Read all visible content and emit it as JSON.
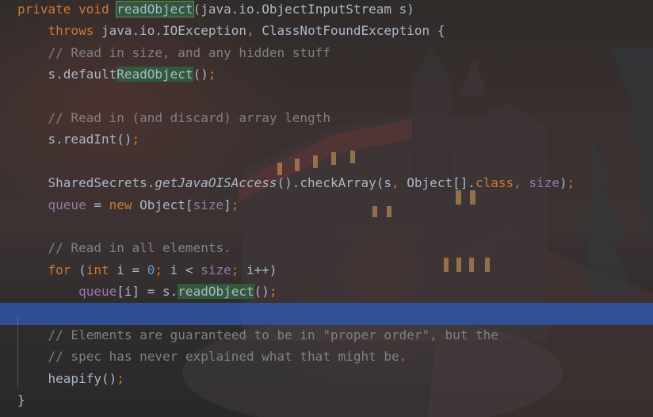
{
  "editor": {
    "lines": [
      {
        "y": 0,
        "tokens": [
          {
            "t": "private void ",
            "c": "kw"
          },
          {
            "t": "readObject",
            "c": "pl hl-box"
          },
          {
            "t": "(java.io.ObjectInputStream s)",
            "c": "pl"
          }
        ]
      },
      {
        "y": 1,
        "tokens": [
          {
            "t": "    throws ",
            "c": "kw"
          },
          {
            "t": "java.io.IOException",
            "c": "pl"
          },
          {
            "t": ", ",
            "c": "kw"
          },
          {
            "t": "ClassNotFoundException {",
            "c": "pl"
          }
        ]
      },
      {
        "y": 2,
        "tokens": [
          {
            "t": "    // Read in size, and any hidden stuff",
            "c": "cm"
          }
        ]
      },
      {
        "y": 3,
        "tokens": [
          {
            "t": "    s.default",
            "c": "pl"
          },
          {
            "t": "ReadObject",
            "c": "pl hl"
          },
          {
            "t": "()",
            "c": "pl"
          },
          {
            "t": ";",
            "c": "kw"
          }
        ]
      },
      {
        "y": 4,
        "tokens": []
      },
      {
        "y": 5,
        "tokens": [
          {
            "t": "    // Read in (and discard) array length",
            "c": "cm"
          }
        ]
      },
      {
        "y": 6,
        "tokens": [
          {
            "t": "    s.readInt()",
            "c": "pl"
          },
          {
            "t": ";",
            "c": "kw"
          }
        ]
      },
      {
        "y": 7,
        "tokens": []
      },
      {
        "y": 8,
        "tokens": [
          {
            "t": "    SharedSecrets.",
            "c": "pl"
          },
          {
            "t": "getJavaOISAccess",
            "c": "it"
          },
          {
            "t": "().checkArray(s",
            "c": "pl"
          },
          {
            "t": ", ",
            "c": "kw"
          },
          {
            "t": "Object[].",
            "c": "pl"
          },
          {
            "t": "class",
            "c": "kw"
          },
          {
            "t": ", ",
            "c": "kw"
          },
          {
            "t": "size",
            "c": "fld"
          },
          {
            "t": ")",
            "c": "pl"
          },
          {
            "t": ";",
            "c": "kw"
          }
        ]
      },
      {
        "y": 9,
        "tokens": [
          {
            "t": "    ",
            "c": "pl"
          },
          {
            "t": "queue",
            "c": "fld"
          },
          {
            "t": " = ",
            "c": "pl"
          },
          {
            "t": "new ",
            "c": "kw"
          },
          {
            "t": "Object[",
            "c": "pl"
          },
          {
            "t": "size",
            "c": "fld"
          },
          {
            "t": "]",
            "c": "pl"
          },
          {
            "t": ";",
            "c": "kw"
          }
        ]
      },
      {
        "y": 10,
        "tokens": []
      },
      {
        "y": 11,
        "tokens": [
          {
            "t": "    // Read in all elements.",
            "c": "cm"
          }
        ]
      },
      {
        "y": 12,
        "tokens": [
          {
            "t": "    for ",
            "c": "kw"
          },
          {
            "t": "(",
            "c": "pl"
          },
          {
            "t": "int ",
            "c": "kw"
          },
          {
            "t": "i = ",
            "c": "pl"
          },
          {
            "t": "0",
            "c": "num"
          },
          {
            "t": "; ",
            "c": "kw"
          },
          {
            "t": "i < ",
            "c": "pl"
          },
          {
            "t": "size",
            "c": "fld"
          },
          {
            "t": "; ",
            "c": "kw"
          },
          {
            "t": "i++)",
            "c": "pl"
          }
        ]
      },
      {
        "y": 13,
        "tokens": [
          {
            "t": "        ",
            "c": "pl"
          },
          {
            "t": "queue",
            "c": "fld"
          },
          {
            "t": "[i] = s.",
            "c": "pl"
          },
          {
            "t": "readObject",
            "c": "pl hl"
          },
          {
            "t": "()",
            "c": "pl"
          },
          {
            "t": ";",
            "c": "kw"
          }
        ]
      },
      {
        "y": 14,
        "tokens": []
      },
      {
        "y": 15,
        "tokens": [
          {
            "t": "    // Elements are guaranteed to be in \"proper order\", but the",
            "c": "cm"
          }
        ]
      },
      {
        "y": 16,
        "tokens": [
          {
            "t": "    // spec has never explained what that might be.",
            "c": "cm"
          }
        ]
      },
      {
        "y": 17,
        "tokens": [
          {
            "t": "    heapify()",
            "c": "pl"
          },
          {
            "t": ";",
            "c": "kw"
          }
        ]
      },
      {
        "y": 18,
        "tokens": [
          {
            "t": "}",
            "c": "pl"
          }
        ]
      }
    ]
  }
}
